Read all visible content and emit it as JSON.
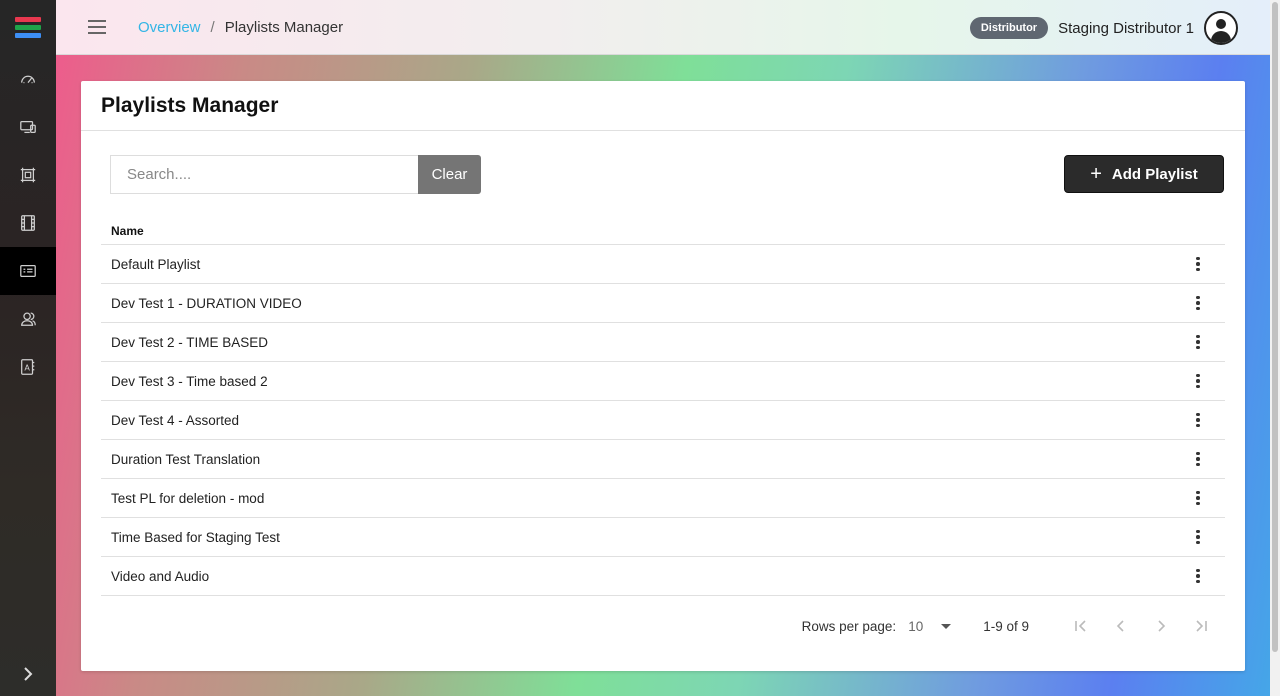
{
  "app": {
    "logo_colors": [
      "#e8384f",
      "#1fa34a",
      "#3d8ff5"
    ]
  },
  "sidebar": {
    "items": [
      {
        "icon": "dashboard-gauge-icon",
        "active": false
      },
      {
        "icon": "devices-icon",
        "active": false
      },
      {
        "icon": "frame-layout-icon",
        "active": false
      },
      {
        "icon": "film-media-icon",
        "active": false
      },
      {
        "icon": "playlist-icon",
        "active": true
      },
      {
        "icon": "users-icon",
        "active": false
      },
      {
        "icon": "contacts-book-icon",
        "active": false
      }
    ],
    "collapse_icon": "chevron-right-icon"
  },
  "header": {
    "breadcrumb_root": "Overview",
    "breadcrumb_separator": "/",
    "breadcrumb_current": "Playlists Manager",
    "role_badge": "Distributor",
    "user_name": "Staging Distributor 1"
  },
  "card": {
    "title": "Playlists Manager",
    "search_placeholder": "Search....",
    "search_value": "",
    "clear_label": "Clear",
    "add_label": "Add Playlist"
  },
  "table": {
    "column_name": "Name",
    "rows": [
      "Default Playlist",
      "Dev Test 1 - DURATION VIDEO",
      "Dev Test 2 - TIME BASED",
      "Dev Test 3 - Time based 2",
      "Dev Test 4 - Assorted",
      "Duration Test Translation",
      "Test PL for deletion - mod",
      "Time Based for Staging Test",
      "Video and Audio"
    ]
  },
  "pagination": {
    "rows_per_page_label": "Rows per page:",
    "rows_per_page_value": "10",
    "range_text": "1-9 of 9"
  }
}
